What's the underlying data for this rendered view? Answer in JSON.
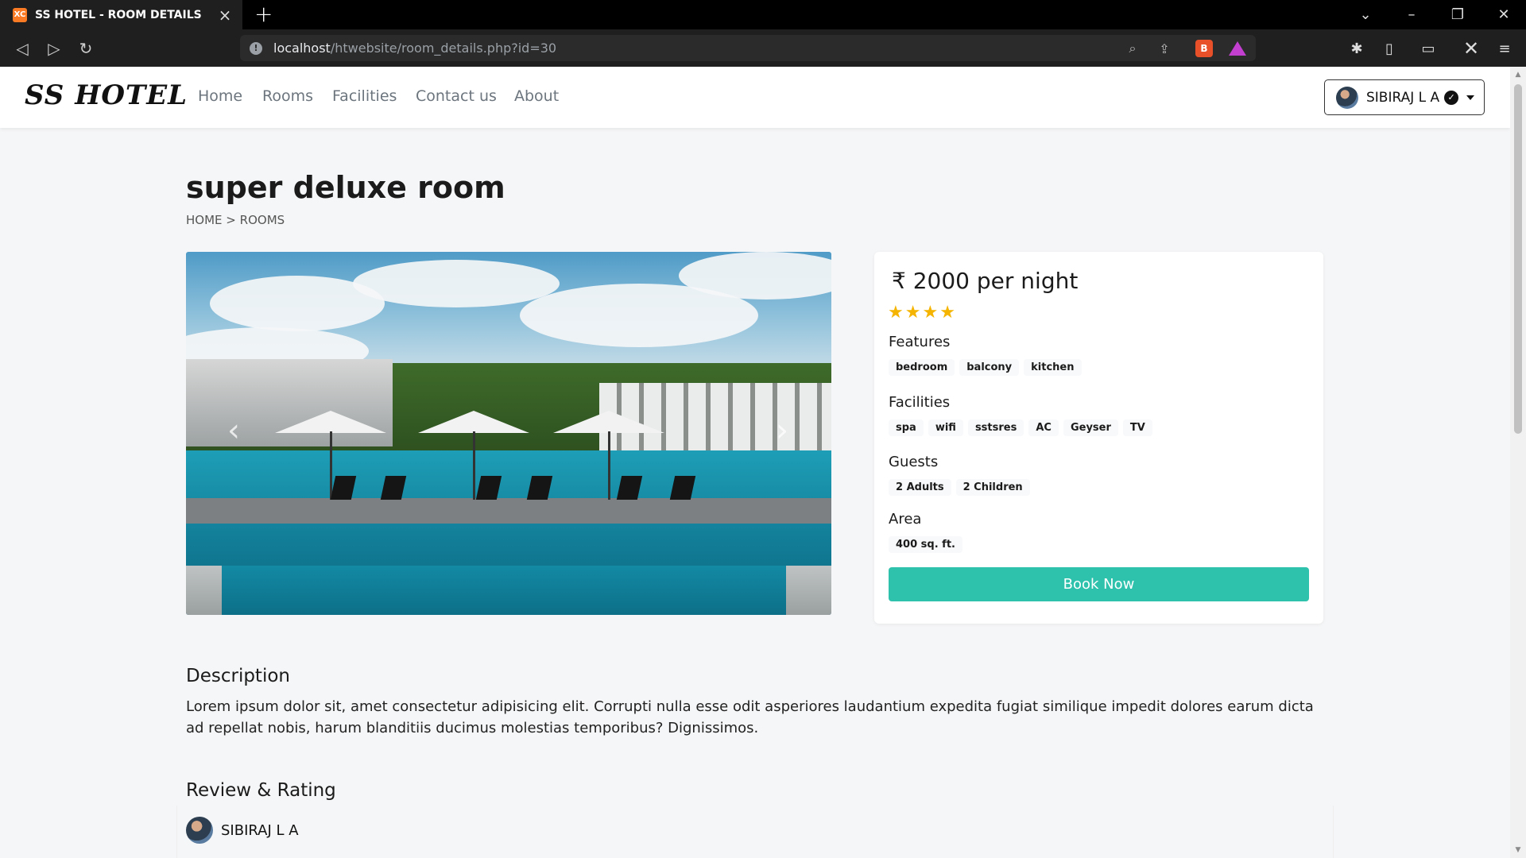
{
  "browser": {
    "tab_title": "SS HOTEL - ROOM DETAILS",
    "favicon_text": "XC",
    "url_host": "localhost",
    "url_path": "/htwebsite/room_details.php?id=30",
    "icons": [
      "back-icon",
      "forward-icon",
      "reload-icon",
      "info-icon",
      "zoom-icon",
      "share-icon",
      "brave-shield-icon",
      "brave-rewards-icon",
      "extensions-icon",
      "sidebar-icon",
      "wallet-icon",
      "custom-extension-icon",
      "menu-icon"
    ]
  },
  "site": {
    "brand": "SS HOTEL",
    "nav": [
      "Home",
      "Rooms",
      "Facilities",
      "Contact us",
      "About"
    ],
    "user": "SIBIRAJ L A"
  },
  "room": {
    "title": "super deluxe room",
    "breadcrumb_home": "HOME",
    "breadcrumb_sep": ">",
    "breadcrumb_rooms": "ROOMS",
    "currency": "₹",
    "price_text": "2000 per night",
    "rating_stars": 4,
    "features_label": "Features",
    "features": [
      "bedroom",
      "balcony",
      "kitchen"
    ],
    "facilities_label": "Facilities",
    "facilities": [
      "spa",
      "wifi",
      "sstsres",
      "AC",
      "Geyser",
      "TV"
    ],
    "guests_label": "Guests",
    "guests": [
      "2 Adults",
      "2 Children"
    ],
    "area_label": "Area",
    "area": "400 sq. ft.",
    "book_label": "Book Now",
    "description_title": "Description",
    "description": "Lorem ipsum dolor sit, amet consectetur adipisicing elit. Corrupti nulla esse odit asperiores laudantium expedita fugiat similique impedit dolores earum dicta ad repellat nobis, harum blanditiis ducimus molestias temporibus? Dignissimos.",
    "review_title": "Review & Rating",
    "reviewer": "SIBIRAJ L A"
  },
  "colors": {
    "accent": "#2ec1ac",
    "star": "#f4b400",
    "browser_bg": "#1f1f1f"
  }
}
